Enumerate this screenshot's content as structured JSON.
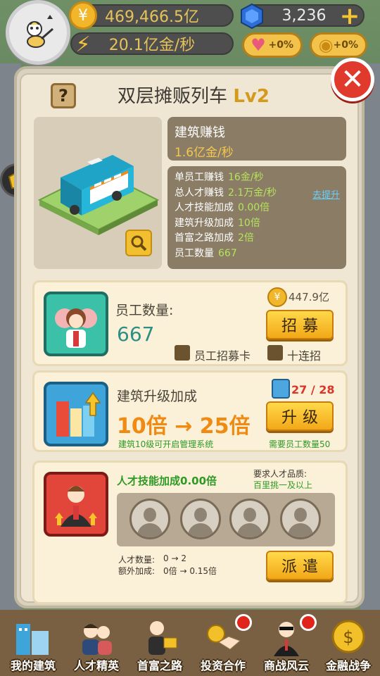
{
  "hud": {
    "coins": "469,466.5亿",
    "rate": "20.1亿金/秒",
    "gems": "3,236",
    "boost_heart": "+0%",
    "boost_coin": "+0%"
  },
  "panel": {
    "title": "双层摊贩列车",
    "level": "Lv2",
    "earn_title": "建筑赚钱",
    "earn_value": "1.6亿金/秒",
    "stats": [
      {
        "label": "单员工赚钱",
        "value": "16金/秒"
      },
      {
        "label": "总人才赚钱",
        "value": "2.1万金/秒"
      },
      {
        "label": "人才技能加成",
        "value": "0.00倍"
      },
      {
        "label": "建筑升级加成",
        "value": "10倍"
      },
      {
        "label": "首富之路加成",
        "value": "2倍"
      },
      {
        "label": "员工数量",
        "value": "667"
      }
    ],
    "promote_link": "去提升"
  },
  "recruit": {
    "label": "员工数量:",
    "count": "667",
    "cost": "447.9亿",
    "button": "招募",
    "option_card": "员工招募卡",
    "option_ten": "十连招"
  },
  "upgrade": {
    "label": "建筑升级加成",
    "value": "10倍 → 25倍",
    "progress": "27 / 28",
    "button": "升级",
    "hint_left": "建筑10级可开启管理系统",
    "hint_right": "需要员工数量50"
  },
  "talent": {
    "label": "人才技能加成0.00倍",
    "req_line1": "要求人才品质:",
    "req_line2": "百里挑一及以上",
    "count_label": "人才数量:",
    "count_value": "0 → 2",
    "extra_label": "额外加成:",
    "extra_value": "0倍 → 0.15倍",
    "button": "派遣"
  },
  "nav": [
    {
      "label": "我的建筑",
      "icon": "building-icon",
      "badge": false
    },
    {
      "label": "人才精英",
      "icon": "talent-icon",
      "badge": false
    },
    {
      "label": "首富之路",
      "icon": "road-icon",
      "badge": false
    },
    {
      "label": "投资合作",
      "icon": "handshake-icon",
      "badge": true
    },
    {
      "label": "商战风云",
      "icon": "boss-icon",
      "badge": true
    },
    {
      "label": "金融战争",
      "icon": "finance-icon",
      "badge": false
    }
  ],
  "colors": {
    "accent_yellow": "#f2a818",
    "title_level": "#d49a1c",
    "value_green": "#b6e35c",
    "close_red": "#e03a2c"
  }
}
